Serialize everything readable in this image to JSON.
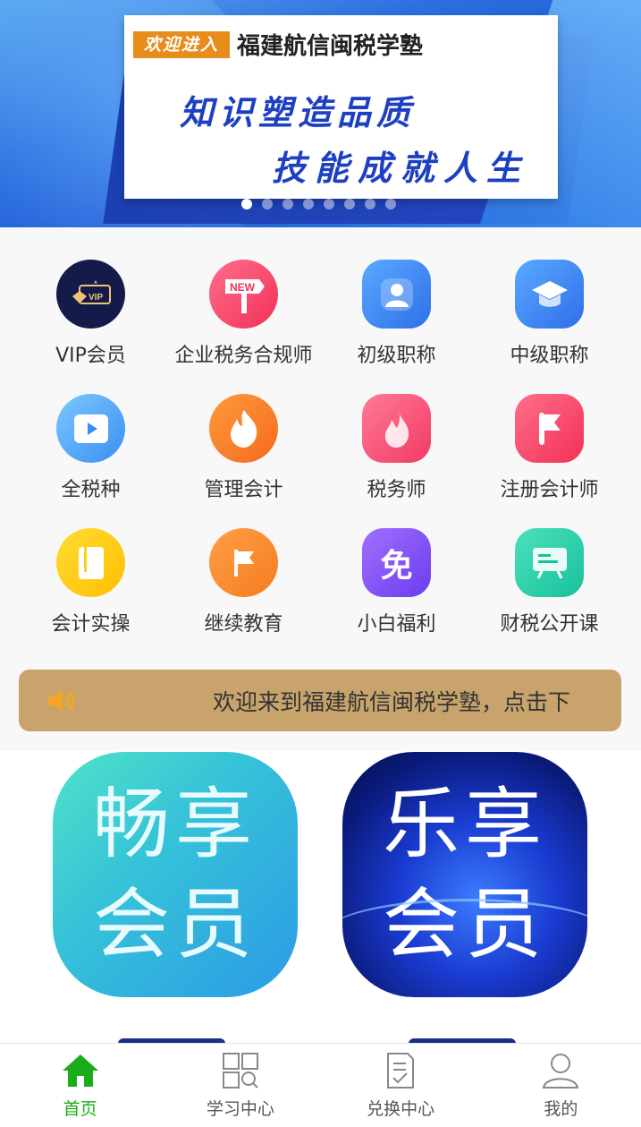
{
  "banner": {
    "tag": "欢迎进入",
    "org": "福建航信闽税学塾",
    "line1": "知识塑造品质",
    "line2": "技能成就人生",
    "slide_count": 8,
    "active_slide": 1
  },
  "grid": [
    {
      "label": "VIP会员",
      "icon": "vip-icon"
    },
    {
      "label": "企业税务合规师",
      "icon": "new-sign-icon"
    },
    {
      "label": "初级职称",
      "icon": "user-icon"
    },
    {
      "label": "中级职称",
      "icon": "graduation-cap-icon"
    },
    {
      "label": "全税种",
      "icon": "play-icon"
    },
    {
      "label": "管理会计",
      "icon": "flame-icon"
    },
    {
      "label": "税务师",
      "icon": "fire-icon"
    },
    {
      "label": "注册会计师",
      "icon": "flag-icon"
    },
    {
      "label": "会计实操",
      "icon": "book-icon"
    },
    {
      "label": "继续教育",
      "icon": "flag-icon"
    },
    {
      "label": "小白福利",
      "icon": "free-icon",
      "glyph": "免"
    },
    {
      "label": "财税公开课",
      "icon": "board-icon"
    }
  ],
  "notice": {
    "text": "欢迎来到福建航信闽税学塾，点击下",
    "icon": "speaker-icon"
  },
  "members": [
    {
      "line1": "畅享",
      "line2": "会员"
    },
    {
      "line1": "乐享",
      "line2": "会员"
    }
  ],
  "tabbar": [
    {
      "label": "首页",
      "icon": "home-icon",
      "active": true
    },
    {
      "label": "学习中心",
      "icon": "study-grid-icon",
      "active": false
    },
    {
      "label": "兑换中心",
      "icon": "document-check-icon",
      "active": false
    },
    {
      "label": "我的",
      "icon": "user-outline-icon",
      "active": false
    }
  ],
  "colors": {
    "accent_green": "#1aad19",
    "notice_bg": "#c8a46c",
    "banner_blue": "#1d3fc4"
  }
}
